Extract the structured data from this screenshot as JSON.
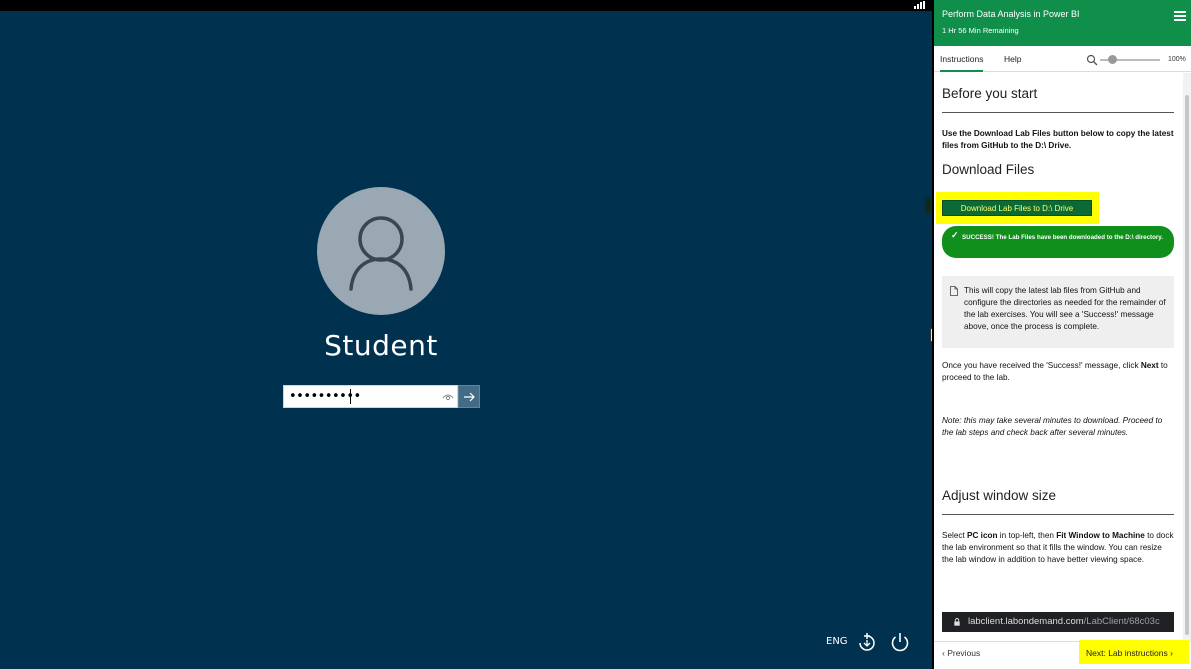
{
  "login": {
    "username": "Student",
    "password_mask": "••••••••••",
    "language": "ENG",
    "bg_color": "#00324f"
  },
  "panel": {
    "title": "Perform Data Analysis in Power BI",
    "time_remaining": "1 Hr 56 Min Remaining",
    "accent_color": "#0f8f4a",
    "tabs": [
      {
        "label": "Instructions"
      },
      {
        "label": "Help"
      }
    ],
    "zoom": "100%",
    "sections": {
      "before_title": "Before you start",
      "before_text": "Use the Download Lab Files button below to copy the latest files from GitHub to the D:\\ Drive.",
      "download_title": "Download Files",
      "download_button": "Download Lab Files to D:\\ Drive",
      "success_msg": "SUCCESS! The Lab Files have been downloaded to the D:\\ directory.",
      "note_text": "This will copy the latest lab files from GitHub and configure the directories as needed for the remainder of the lab exercises. You will see a 'Success!' message above, once the process is complete.",
      "once_text_pre": "Once you have received the 'Success!' message, click ",
      "once_text_bold": "Next",
      "once_text_post": " to proceed to the lab.",
      "italic_note": "Note: this may take several minutes to download. Proceed to the lab steps and check back after several minutes.",
      "adjust_title": "Adjust window size",
      "adjust_p1": "Select ",
      "adjust_b1": "PC icon",
      "adjust_p2": " in top-left, then ",
      "adjust_b2": "Fit Window to Machine",
      "adjust_p3": " to dock the lab environment so that it fills the window. You can resize the lab window in addition to have better viewing space.",
      "url_host": "labclient.labondemand.com",
      "url_path": "/LabClient/68c03c"
    },
    "footer": {
      "previous": "Previous",
      "next": "Next: Lab instructions"
    }
  }
}
